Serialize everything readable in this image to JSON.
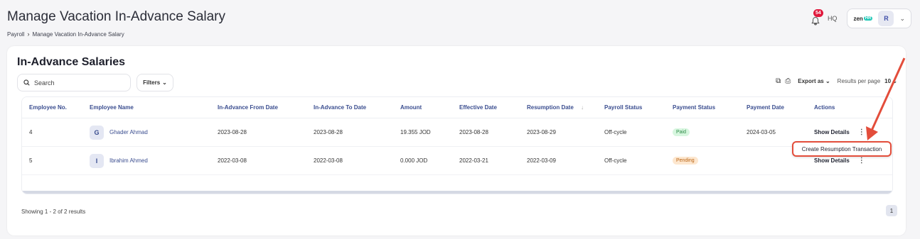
{
  "header": {
    "title": "Manage Vacation In-Advance Salary",
    "breadcrumb": [
      "Payroll",
      "Manage Vacation In-Advance Salary"
    ],
    "notification_count": "54",
    "company": "HQ",
    "logo_text": "zen",
    "logo_badge": "HR",
    "user_initial": "R"
  },
  "card": {
    "title": "In-Advance Salaries",
    "search_placeholder": "Search",
    "filters_label": "Filters",
    "export_label": "Export as",
    "results_per_page_label": "Results per page",
    "results_per_page_value": "10"
  },
  "table": {
    "columns": [
      "Employee No.",
      "Employee Name",
      "In-Advance From Date",
      "In-Advance To Date",
      "Amount",
      "Effective Date",
      "Resumption Date",
      "Payroll Status",
      "Payment Status",
      "Payment Date",
      "Actions"
    ],
    "rows": [
      {
        "employee_no": "4",
        "initial": "G",
        "employee_name": "Ghader Ahmad",
        "from_date": "2023-08-28",
        "to_date": "2023-08-28",
        "amount": "19.355 JOD",
        "effective_date": "2023-08-28",
        "resumption_date": "2023-08-29",
        "payroll_status": "Off-cycle",
        "payment_status": "Paid",
        "payment_date": "2024-03-05",
        "action": "Show Details"
      },
      {
        "employee_no": "5",
        "initial": "I",
        "employee_name": "Ibrahim Ahmed",
        "from_date": "2022-03-08",
        "to_date": "2022-03-08",
        "amount": "0.000 JOD",
        "effective_date": "2022-03-21",
        "resumption_date": "2022-03-09",
        "payroll_status": "Off-cycle",
        "payment_status": "Pending",
        "payment_date": "",
        "action": "Show Details"
      }
    ]
  },
  "dropdown_menu": {
    "item": "Create Resumption Transaction"
  },
  "footer": {
    "showing": "Showing 1 - 2 of 2 results",
    "current_page": "1"
  },
  "colors": {
    "accent": "#3a4d8f",
    "highlight": "#e34d3b",
    "paid_bg": "#d7f6df",
    "pending_bg": "#fde7cf",
    "badge_red": "#e0183c"
  }
}
